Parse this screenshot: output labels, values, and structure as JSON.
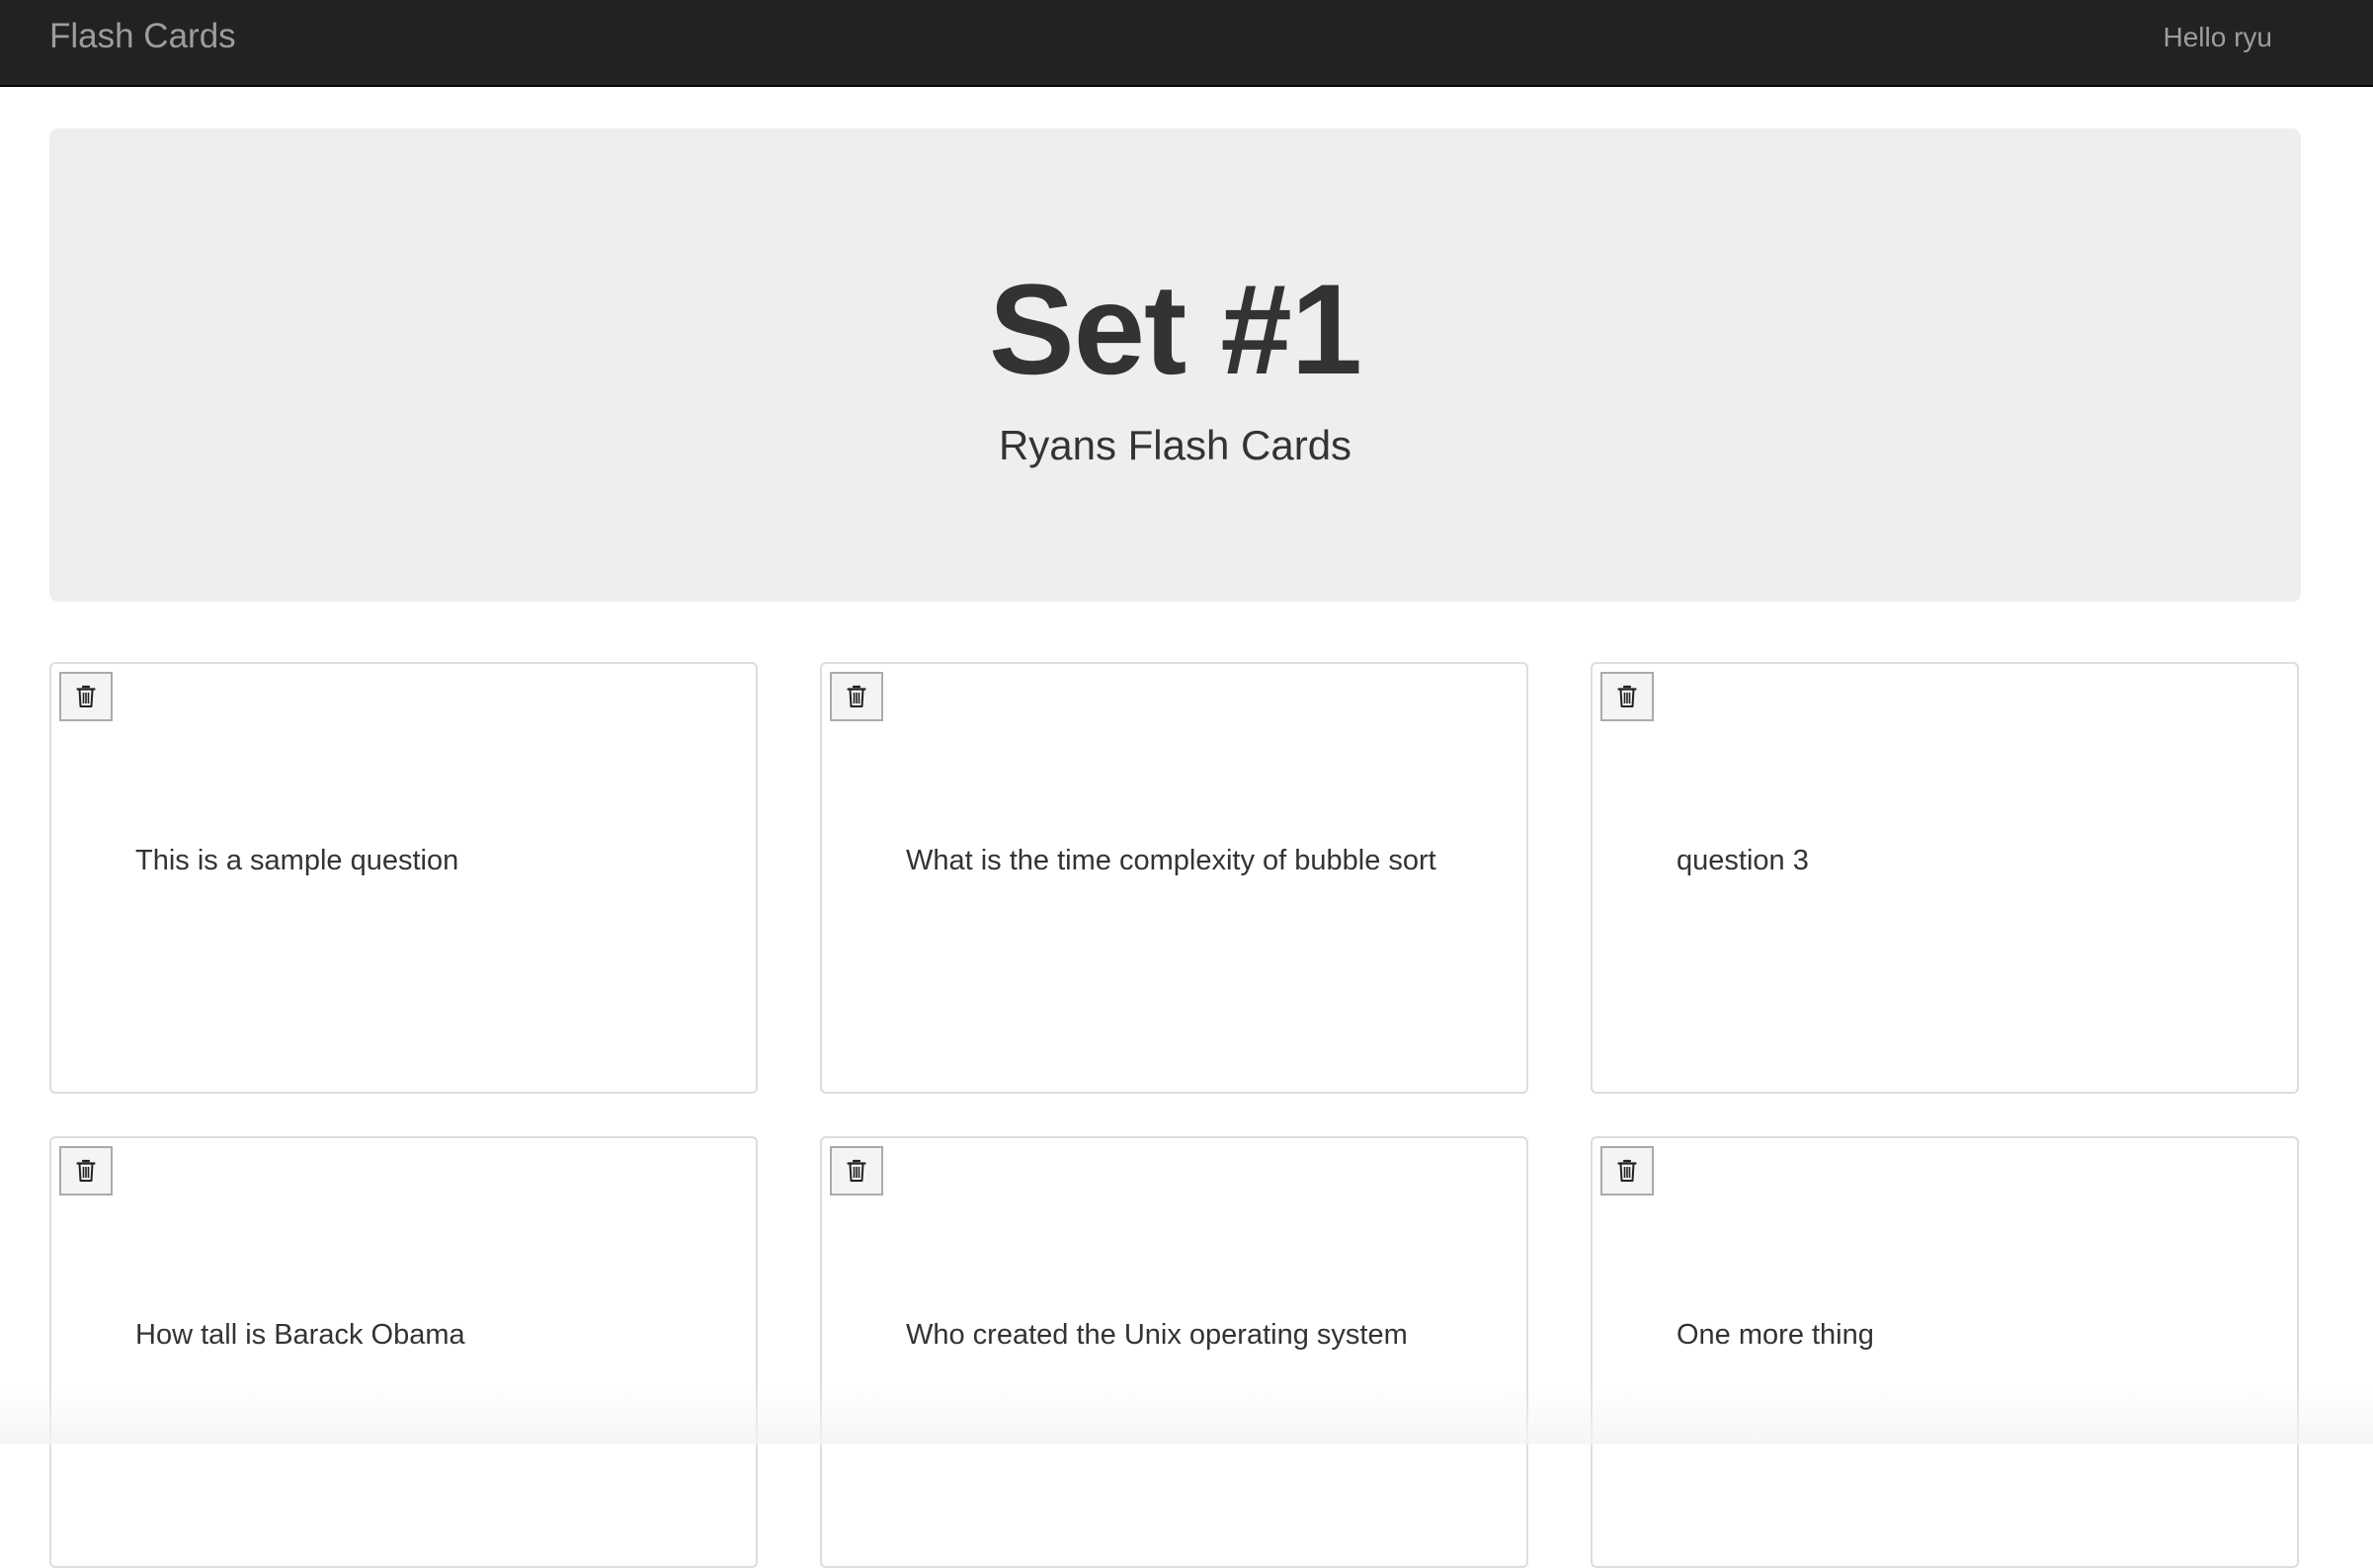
{
  "navbar": {
    "brand": "Flash Cards",
    "greeting": "Hello ryu"
  },
  "jumbotron": {
    "title": "Set #1",
    "subtitle": "Ryans Flash Cards"
  },
  "cards": [
    {
      "question": "This is a sample question",
      "delete_icon": "trash-icon"
    },
    {
      "question": "What is the time complexity of bubble sort",
      "delete_icon": "trash-icon"
    },
    {
      "question": "question 3",
      "delete_icon": "trash-icon"
    },
    {
      "question": "How tall is Barack Obama",
      "delete_icon": "trash-icon"
    },
    {
      "question": "Who created the Unix operating system",
      "delete_icon": "trash-icon"
    },
    {
      "question": "One more thing",
      "delete_icon": "trash-icon"
    }
  ],
  "colors": {
    "navbar_bg": "#222222",
    "navbar_text": "#9d9d9d",
    "jumbotron_bg": "#eeeeee",
    "text": "#333333",
    "card_border": "#dddddd"
  }
}
